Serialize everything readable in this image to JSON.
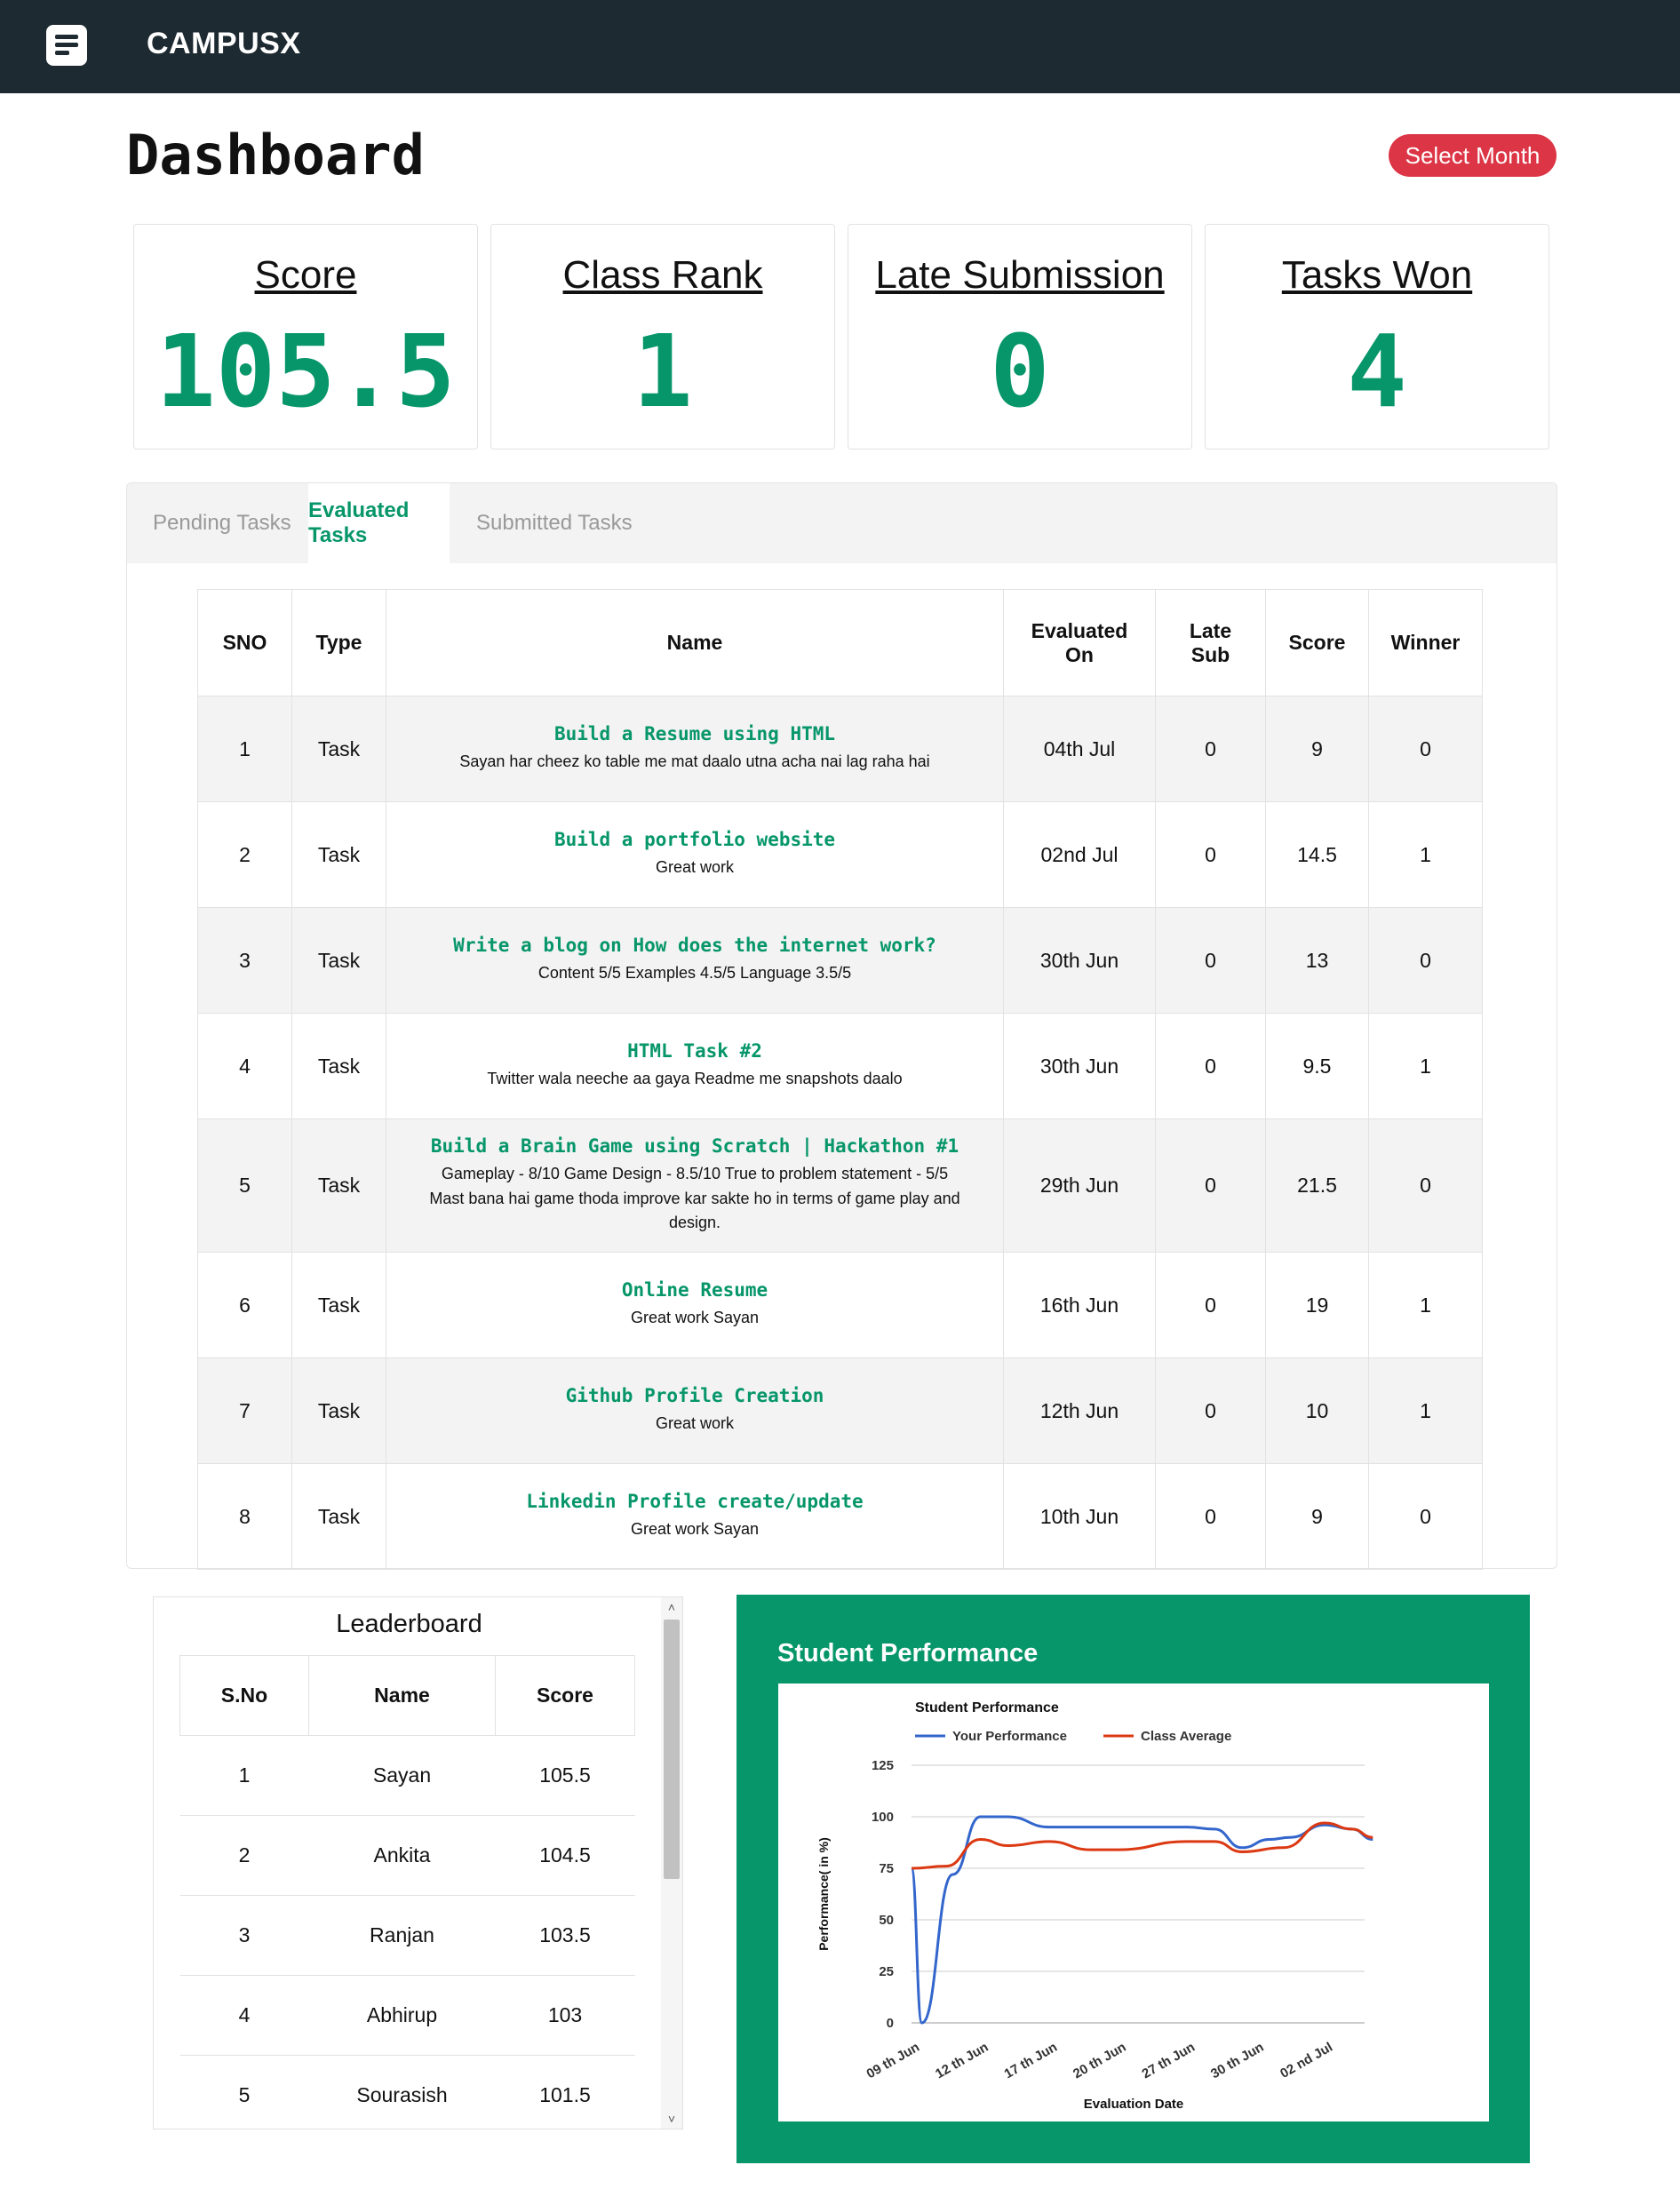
{
  "app": {
    "brand": "CAMPUSX",
    "menu_icon": "menu-icon"
  },
  "header": {
    "title": "Dashboard",
    "select_month_label": "Select Month"
  },
  "stats": [
    {
      "label": "Score",
      "value": "105.5"
    },
    {
      "label": "Class Rank",
      "value": "1"
    },
    {
      "label": "Late Submission",
      "value": "0"
    },
    {
      "label": "Tasks Won",
      "value": "4"
    }
  ],
  "tabs": [
    {
      "label": "Pending Tasks",
      "active": false
    },
    {
      "label": "Evaluated Tasks",
      "active": true
    },
    {
      "label": "Submitted Tasks",
      "active": false
    }
  ],
  "tasks_table": {
    "headers": [
      "SNO",
      "Type",
      "Name",
      "Evaluated On",
      "Late Sub",
      "Score",
      "Winner"
    ],
    "rows": [
      {
        "sno": "1",
        "type": "Task",
        "name": "Build a Resume using HTML",
        "remark": "Sayan har cheez ko table me mat daalo utna acha nai lag raha hai",
        "evaluated_on": "04th Jul",
        "late_sub": "0",
        "score": "9",
        "winner": "0"
      },
      {
        "sno": "2",
        "type": "Task",
        "name": "Build a portfolio website",
        "remark": "Great work",
        "evaluated_on": "02nd Jul",
        "late_sub": "0",
        "score": "14.5",
        "winner": "1"
      },
      {
        "sno": "3",
        "type": "Task",
        "name": "Write a blog on How does the internet work?",
        "remark": "Content 5/5 Examples 4.5/5 Language 3.5/5",
        "evaluated_on": "30th Jun",
        "late_sub": "0",
        "score": "13",
        "winner": "0"
      },
      {
        "sno": "4",
        "type": "Task",
        "name": "HTML Task #2",
        "remark": "Twitter wala neeche aa gaya Readme me snapshots daalo",
        "evaluated_on": "30th Jun",
        "late_sub": "0",
        "score": "9.5",
        "winner": "1"
      },
      {
        "sno": "5",
        "type": "Task",
        "name": "Build a Brain Game using Scratch | Hackathon #1",
        "remark": "Gameplay - 8/10 Game Design - 8.5/10 True to problem statement - 5/5 Mast bana hai game thoda improve kar sakte ho in terms of game play and design.",
        "evaluated_on": "29th Jun",
        "late_sub": "0",
        "score": "21.5",
        "winner": "0"
      },
      {
        "sno": "6",
        "type": "Task",
        "name": "Online Resume",
        "remark": "Great work Sayan",
        "evaluated_on": "16th Jun",
        "late_sub": "0",
        "score": "19",
        "winner": "1"
      },
      {
        "sno": "7",
        "type": "Task",
        "name": "Github Profile Creation",
        "remark": "Great work",
        "evaluated_on": "12th Jun",
        "late_sub": "0",
        "score": "10",
        "winner": "1"
      },
      {
        "sno": "8",
        "type": "Task",
        "name": "Linkedin Profile create/update",
        "remark": "Great work Sayan",
        "evaluated_on": "10th Jun",
        "late_sub": "0",
        "score": "9",
        "winner": "0"
      }
    ]
  },
  "leaderboard": {
    "title": "Leaderboard",
    "headers": [
      "S.No",
      "Name",
      "Score"
    ],
    "rows": [
      {
        "sno": "1",
        "name": "Sayan",
        "score": "105.5"
      },
      {
        "sno": "2",
        "name": "Ankita",
        "score": "104.5"
      },
      {
        "sno": "3",
        "name": "Ranjan",
        "score": "103.5"
      },
      {
        "sno": "4",
        "name": "Abhirup",
        "score": "103"
      },
      {
        "sno": "5",
        "name": "Sourasish",
        "score": "101.5"
      }
    ]
  },
  "performance": {
    "panel_title": "Student Performance"
  },
  "chart_data": {
    "type": "line",
    "title": "Student Performance",
    "xlabel": "Evaluation Date",
    "ylabel": "Performance( in %)",
    "ylim": [
      0,
      125
    ],
    "yticks": [
      0,
      25,
      50,
      75,
      100,
      125
    ],
    "x_tick_labels": [
      "09 th Jun",
      "12 th Jun",
      "17 th Jun",
      "20 th Jun",
      "27 th Jun",
      "30 th Jun",
      "02 nd Jul"
    ],
    "legend_position": "top",
    "grid": true,
    "series": [
      {
        "name": "Your Performance",
        "color": "#3366cc",
        "points": [
          [
            0,
            75
          ],
          [
            0.15,
            0
          ],
          [
            0.6,
            72
          ],
          [
            1,
            100
          ],
          [
            1.4,
            100
          ],
          [
            2,
            95
          ],
          [
            3,
            95
          ],
          [
            4,
            95
          ],
          [
            4.4,
            94
          ],
          [
            4.8,
            85
          ],
          [
            5.2,
            89
          ],
          [
            5.5,
            90
          ],
          [
            6,
            96
          ],
          [
            6.4,
            94
          ],
          [
            6.7,
            89
          ]
        ]
      },
      {
        "name": "Class Average",
        "color": "#dc3912",
        "points": [
          [
            0,
            75
          ],
          [
            0.5,
            76
          ],
          [
            1,
            89
          ],
          [
            1.4,
            86
          ],
          [
            2,
            88
          ],
          [
            2.6,
            84
          ],
          [
            3,
            84
          ],
          [
            4,
            88
          ],
          [
            4.4,
            88
          ],
          [
            4.8,
            83
          ],
          [
            5.4,
            85
          ],
          [
            6,
            97
          ],
          [
            6.4,
            94
          ],
          [
            6.7,
            90
          ]
        ]
      }
    ]
  }
}
